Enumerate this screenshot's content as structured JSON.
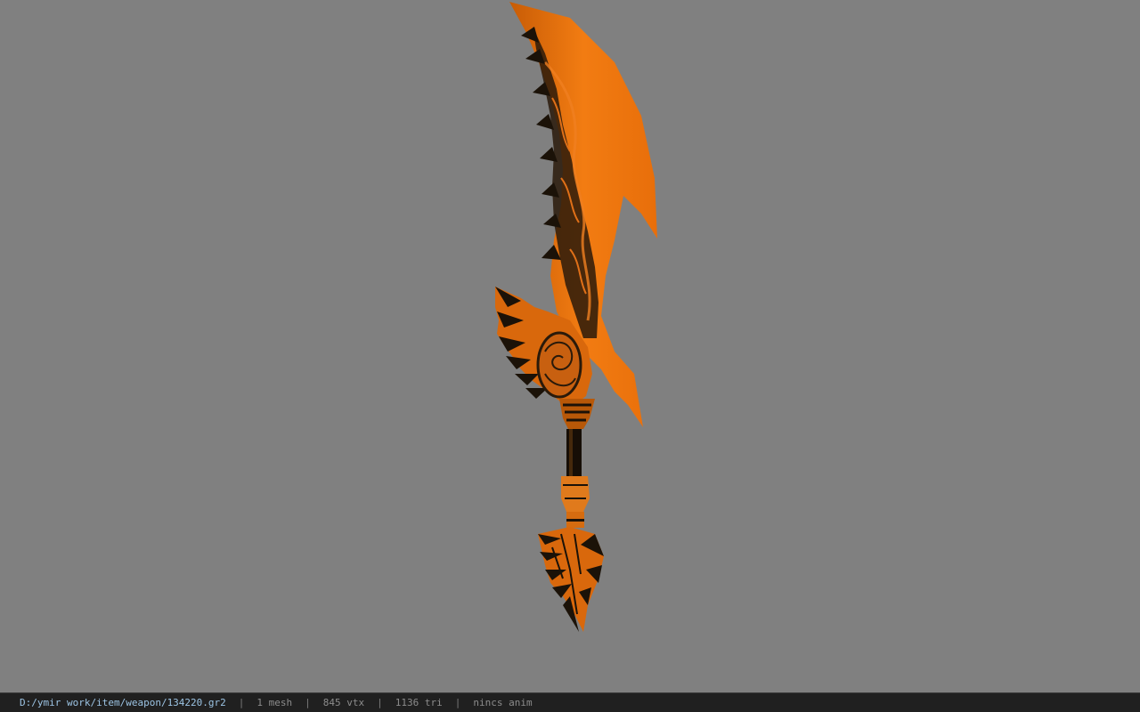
{
  "viewport": {
    "background": "#808080",
    "model_icon": "sword-model",
    "model_colors": {
      "blade": "#f07a10",
      "dark": "#1b1208",
      "mid": "#c05a08"
    }
  },
  "status_bar": {
    "file_path": "D:/ymir work/item/weapon/134220.gr2",
    "separator": "|",
    "mesh": "1 mesh",
    "vertices": "845 vtx",
    "triangles": "1136 tri",
    "animation": "nincs anim"
  }
}
